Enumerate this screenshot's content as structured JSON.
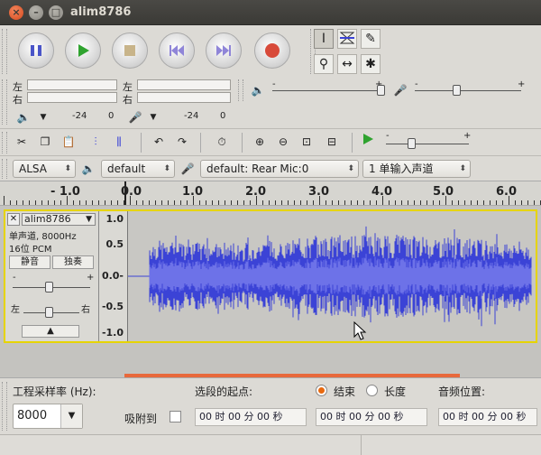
{
  "window": {
    "title": "alim8786"
  },
  "meters": {
    "left_label": "左",
    "right_label": "右",
    "play_db": "-24",
    "play_zero": "0",
    "rec_db": "-24",
    "rec_zero": "0"
  },
  "mixer": {
    "slider_minus": "-",
    "slider_plus": "+"
  },
  "device": {
    "host": "ALSA",
    "output": "default",
    "input": "default: Rear Mic:0",
    "channels": "1 单输入声道"
  },
  "ruler": {
    "ticks": [
      "- 1.0",
      "0.0",
      "1.0",
      "2.0",
      "3.0",
      "4.0",
      "5.0",
      "6.0"
    ]
  },
  "track": {
    "name": "alim8786",
    "format_line": "单声道, 8000Hz",
    "bit_line": "16位 PCM",
    "mute": "静音",
    "solo": "独奏",
    "gain_minus": "-",
    "gain_plus": "+",
    "pan_left": "左",
    "pan_right": "右",
    "scale": [
      "1.0",
      "0.5",
      "0.0-",
      "-0.5",
      "-1.0"
    ]
  },
  "bottom": {
    "rate_label": "工程采样率 (Hz):",
    "rate_value": "8000",
    "snap_label": "吸附到",
    "sel_start_label": "选段的起点:",
    "end_label": "结束",
    "length_label": "长度",
    "pos_label": "音频位置:",
    "time_start": "00 时 00 分 00 秒",
    "time_end": "00 时 00 分 00 秒",
    "time_pos": "00 时 00 分 00 秒"
  },
  "colors": {
    "wave": "#3b43d6",
    "wave_light": "#6d72e8",
    "selection_border": "#e6d400",
    "record": "#d84a3a",
    "play": "#2fa32f",
    "pause": "#4a55c8"
  }
}
